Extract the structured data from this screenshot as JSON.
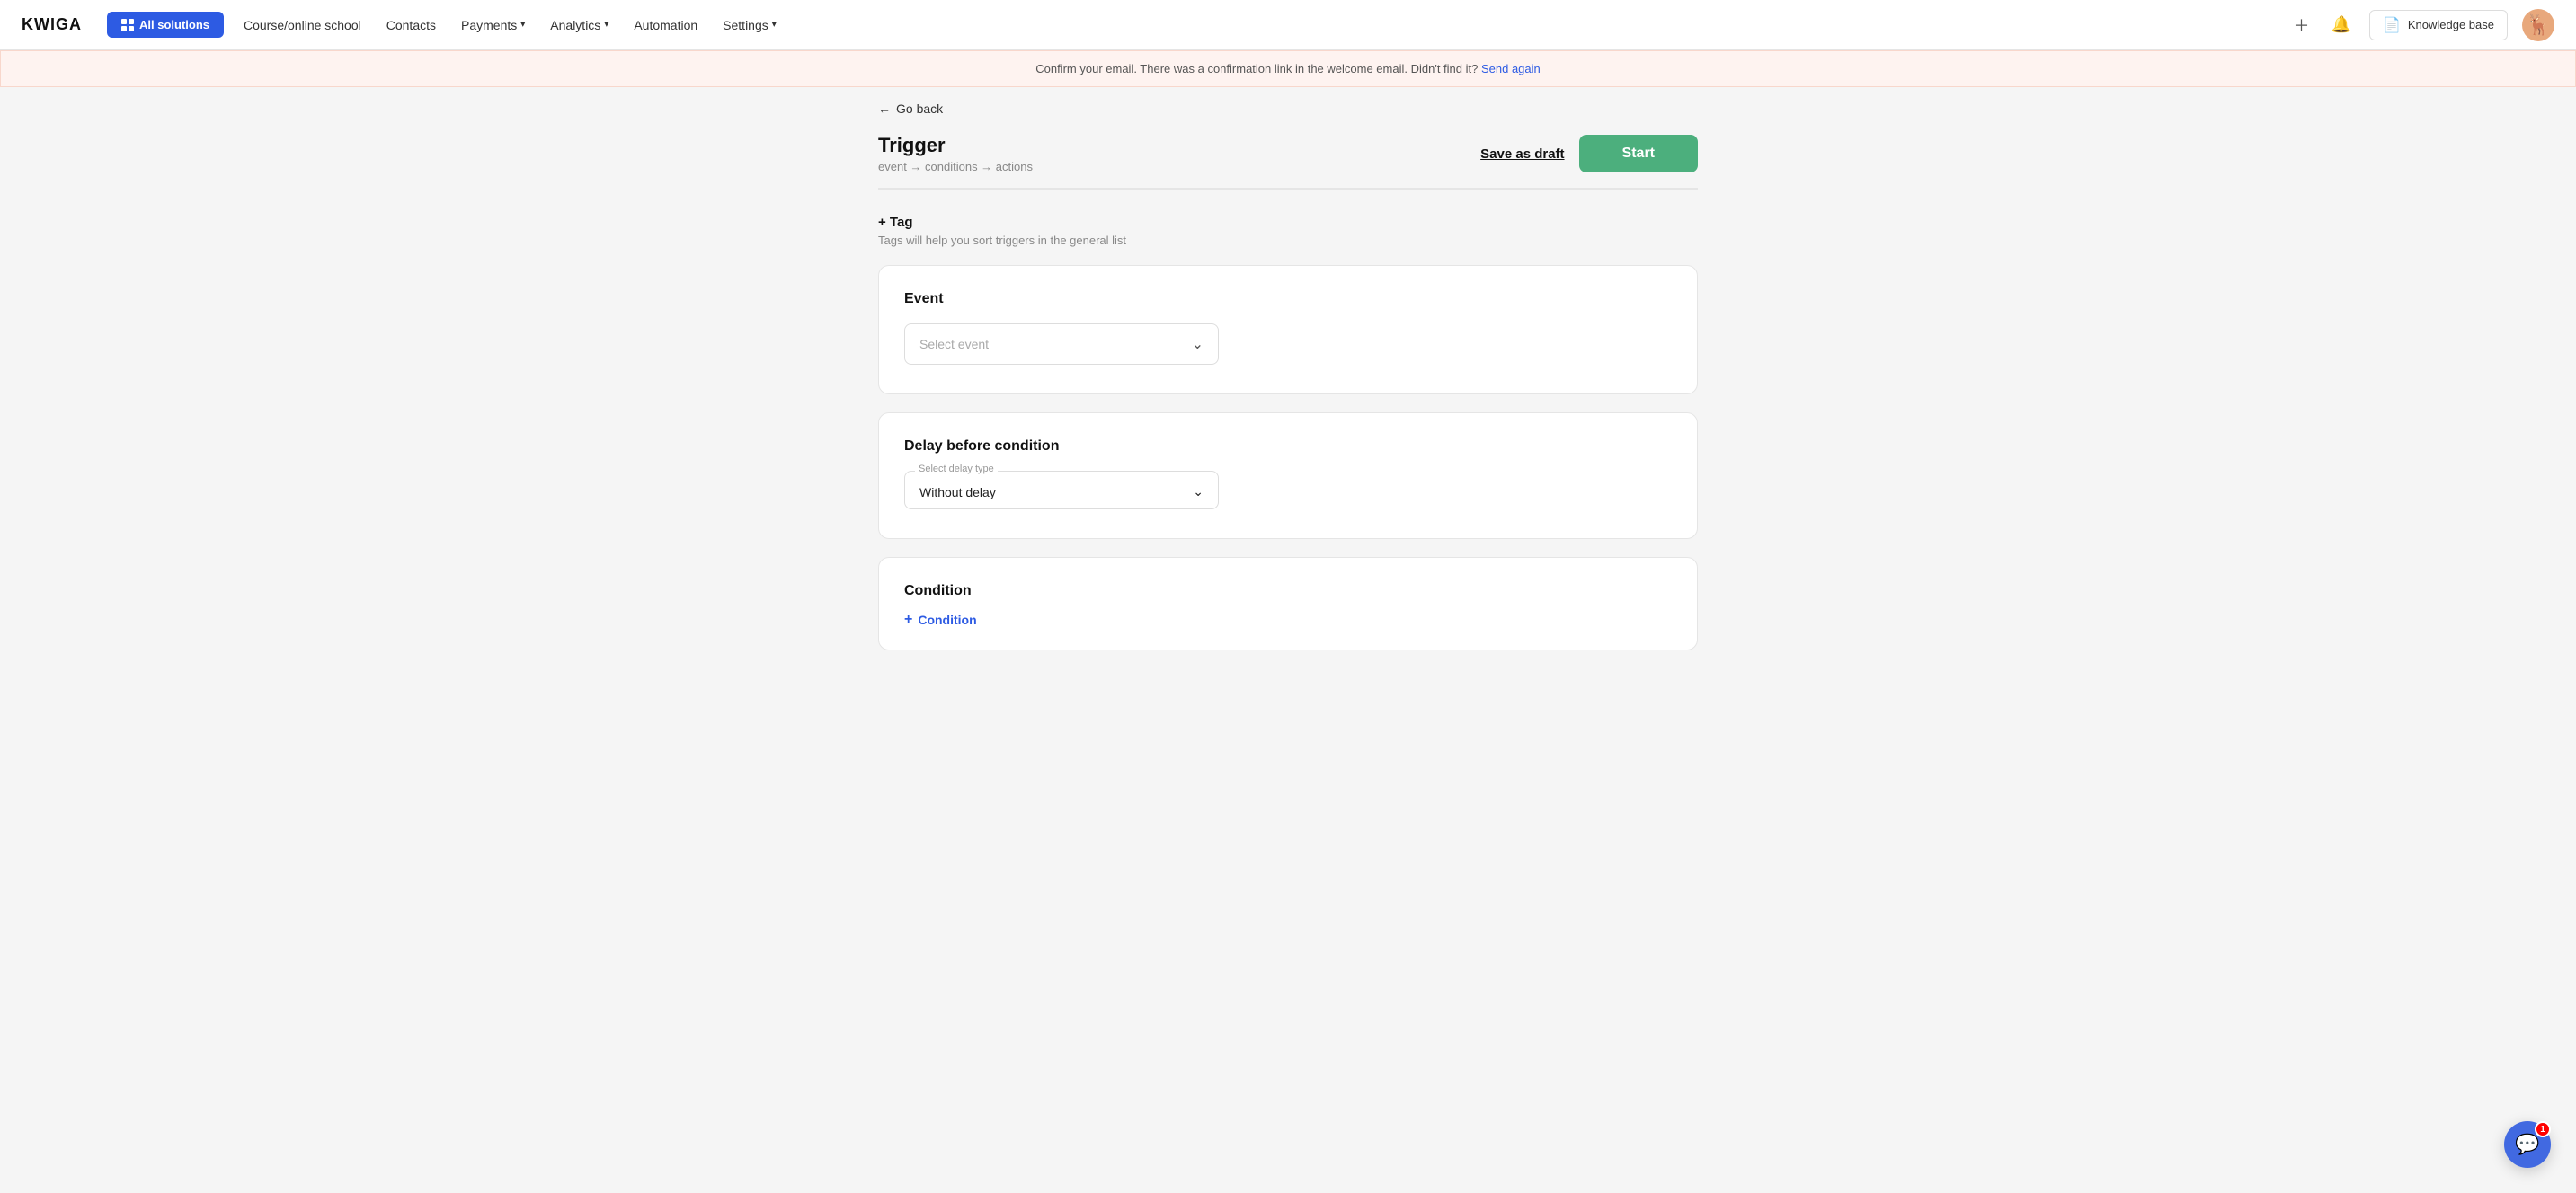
{
  "brand": {
    "logo": "KWIGA"
  },
  "nav": {
    "all_solutions_label": "All solutions",
    "links": [
      {
        "label": "Course/online school",
        "has_dropdown": false
      },
      {
        "label": "Contacts",
        "has_dropdown": false
      },
      {
        "label": "Payments",
        "has_dropdown": true
      },
      {
        "label": "Analytics",
        "has_dropdown": true
      },
      {
        "label": "Automation",
        "has_dropdown": false
      },
      {
        "label": "Settings",
        "has_dropdown": true
      }
    ],
    "knowledge_base_label": "Knowledge base",
    "chat_badge_count": "1"
  },
  "banner": {
    "text": "Confirm your email. There was a confirmation link in the welcome email. Didn't find it?",
    "link_label": "Send again"
  },
  "back": {
    "label": "Go back"
  },
  "page": {
    "title": "Trigger",
    "subtitle": "event → conditions → actions",
    "save_draft_label": "Save as draft",
    "start_label": "Start"
  },
  "tag_section": {
    "add_label": "+ Tag",
    "help_text": "Tags will help you sort triggers in the general list"
  },
  "event_card": {
    "title": "Event",
    "select_placeholder": "Select event"
  },
  "delay_card": {
    "title": "Delay before condition",
    "select_label": "Select delay type",
    "select_value": "Without delay"
  },
  "condition_card": {
    "title": "Condition",
    "add_label": "+ Condition"
  }
}
